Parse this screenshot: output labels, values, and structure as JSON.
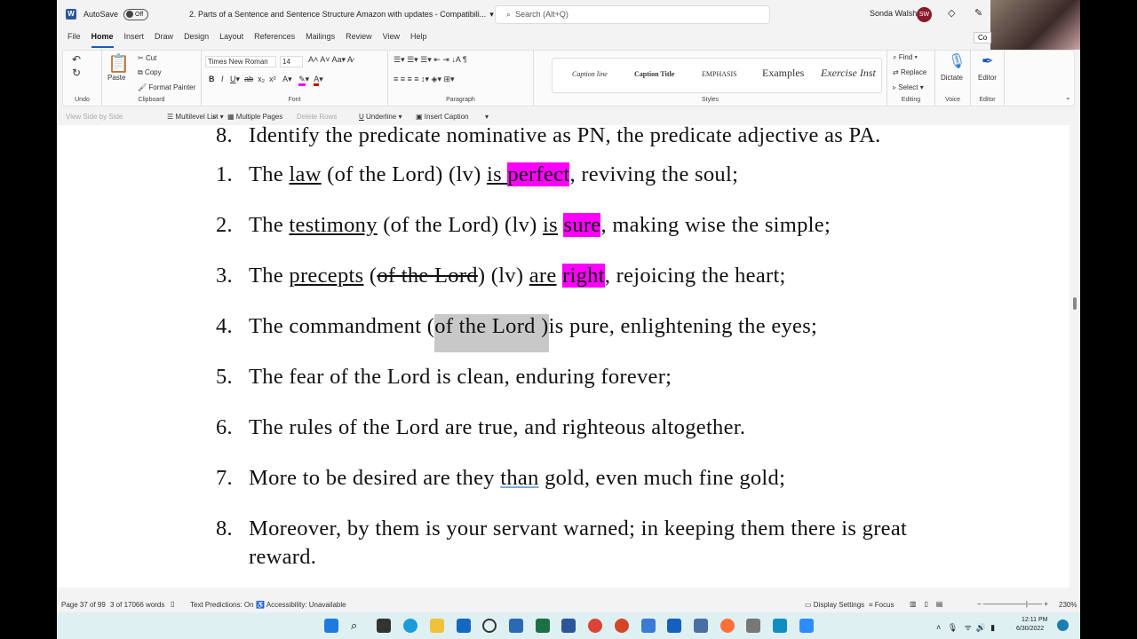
{
  "titlebar": {
    "autosave": "AutoSave",
    "autosave_state": "Off",
    "doc_title": "2. Parts of a Sentence and Sentence Structure Amazon with updates  -  Compatibili...",
    "search_placeholder": "Search (Alt+Q)",
    "user": "Sonda Walsh",
    "initials": "SW"
  },
  "tabs": [
    "File",
    "Home",
    "Insert",
    "Draw",
    "Design",
    "Layout",
    "References",
    "Mailings",
    "Review",
    "View",
    "Help"
  ],
  "ribbon": {
    "undo_label": "Undo",
    "paste": "Paste",
    "cut": "Cut",
    "copy": "Copy",
    "format_painter": "Format Painter",
    "clipboard_label": "Clipboard",
    "font_name": "Times New Roman",
    "font_size": "14",
    "font_label": "Font",
    "paragraph_label": "Paragraph",
    "styles": [
      "Caption line",
      "Caption Title",
      "EMPHASIS",
      "Examples",
      "Exercise Inst"
    ],
    "styles_label": "Styles",
    "find": "Find",
    "replace": "Replace",
    "select": "Select",
    "editing_label": "Editing",
    "dictate": "Dictate",
    "voice_label": "Voice",
    "editor": "Editor",
    "editor_label": "Editor",
    "comments": "Co"
  },
  "quickbar": {
    "view_side": "View Side by Side",
    "multilevel": "Multilevel List",
    "multiple_pages": "Multiple Pages",
    "delete_rows": "Delete Rows",
    "underline": "Underline",
    "insert_caption": "Insert Caption"
  },
  "document": {
    "lines": [
      {
        "num": "8.",
        "segs": [
          {
            "t": "Identify the predicate nominative as PN, the predicate adjective as PA.",
            "s": ""
          }
        ]
      },
      {
        "num": "1.",
        "segs": [
          {
            "t": "The ",
            "s": ""
          },
          {
            "t": "law",
            "s": "u"
          },
          {
            "t": " (of the Lord) (lv) ",
            "s": ""
          },
          {
            "t": "is ",
            "s": "u"
          },
          {
            "t": "perfect",
            "s": "hl"
          },
          {
            "t": ", reviving the soul;",
            "s": ""
          }
        ]
      },
      {
        "num": "2.",
        "segs": [
          {
            "t": "The ",
            "s": ""
          },
          {
            "t": "testimony",
            "s": "u"
          },
          {
            "t": " (of the Lord) (lv) ",
            "s": ""
          },
          {
            "t": "is",
            "s": "u"
          },
          {
            "t": " ",
            "s": ""
          },
          {
            "t": "sure",
            "s": "hl"
          },
          {
            "t": ", making wise the simple;",
            "s": ""
          }
        ]
      },
      {
        "num": "3.",
        "segs": [
          {
            "t": "The ",
            "s": ""
          },
          {
            "t": "precepts",
            "s": "u"
          },
          {
            "t": " (",
            "s": ""
          },
          {
            "t": "of the Lord",
            "s": "st"
          },
          {
            "t": ") (lv) ",
            "s": ""
          },
          {
            "t": "are",
            "s": "u"
          },
          {
            "t": " ",
            "s": ""
          },
          {
            "t": "right",
            "s": "hl"
          },
          {
            "t": ", rejoicing the heart;",
            "s": ""
          }
        ]
      },
      {
        "num": "4.",
        "segs": [
          {
            "t": "The commandment (",
            "s": ""
          },
          {
            "t": "of the Lord )",
            "s": "sel"
          },
          {
            "t": "is pure, enlightening the eyes;",
            "s": ""
          }
        ]
      },
      {
        "num": "5.",
        "segs": [
          {
            "t": "The fear of the Lord is clean, enduring forever;",
            "s": ""
          }
        ]
      },
      {
        "num": "6.",
        "segs": [
          {
            "t": "The rules of the Lord are true, and righteous altogether.",
            "s": ""
          }
        ]
      },
      {
        "num": "7.",
        "segs": [
          {
            "t": "More to be desired are they ",
            "s": ""
          },
          {
            "t": "than",
            "s": "gu"
          },
          {
            "t": " gold, even much fine gold;",
            "s": ""
          }
        ]
      },
      {
        "num": "8.",
        "segs": [
          {
            "t": "Moreover, by them is your servant warned; in keeping them there is great",
            "s": ""
          }
        ]
      },
      {
        "num": "",
        "segs": [
          {
            "t": "reward.",
            "s": ""
          }
        ]
      }
    ]
  },
  "status": {
    "page": "Page 37 of 99",
    "words": "3 of 17066 words",
    "predictions": "Text Predictions: On",
    "accessibility": "Accessibility: Unavailable",
    "display": "Display Settings",
    "focus": "Focus",
    "zoom": "230%"
  },
  "taskbar": {
    "time": "12:11 PM",
    "date": "6/30/2022"
  }
}
